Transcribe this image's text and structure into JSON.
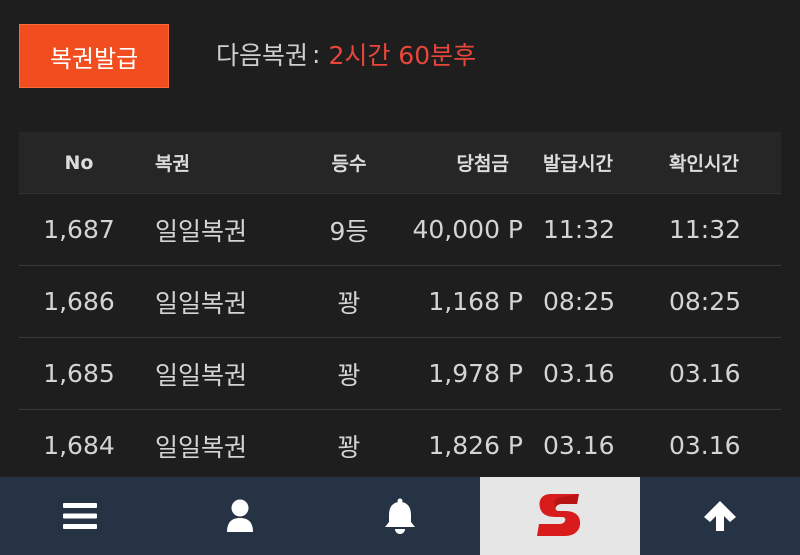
{
  "header": {
    "issue_button_label": "복권발급",
    "next_label": "다음복권",
    "colon": ":",
    "next_time": "2시간 60분후"
  },
  "table": {
    "columns": [
      "No",
      "복권",
      "등수",
      "당첨금",
      "발급시간",
      "확인시간"
    ],
    "rows": [
      {
        "no": "1,687",
        "type": "일일복권",
        "rank": "9등",
        "prize": "40,000 P",
        "issued": "11:32",
        "checked": "11:32"
      },
      {
        "no": "1,686",
        "type": "일일복권",
        "rank": "꽝",
        "prize": "1,168 P",
        "issued": "08:25",
        "checked": "08:25"
      },
      {
        "no": "1,685",
        "type": "일일복권",
        "rank": "꽝",
        "prize": "1,978 P",
        "issued": "03.16",
        "checked": "03.16"
      },
      {
        "no": "1,684",
        "type": "일일복권",
        "rank": "꽝",
        "prize": "1,826 P",
        "issued": "03.16",
        "checked": "03.16"
      }
    ]
  },
  "bottom_nav": {
    "items": [
      {
        "icon": "menu-icon"
      },
      {
        "icon": "user-icon"
      },
      {
        "icon": "bell-icon"
      },
      {
        "icon": "logo-s-icon",
        "active": true
      },
      {
        "icon": "arrow-up-icon"
      }
    ]
  },
  "colors": {
    "accent": "#f14d1f",
    "next_time": "#e8463a",
    "nav_bg": "#253345",
    "page_bg": "#1e1e1e"
  }
}
